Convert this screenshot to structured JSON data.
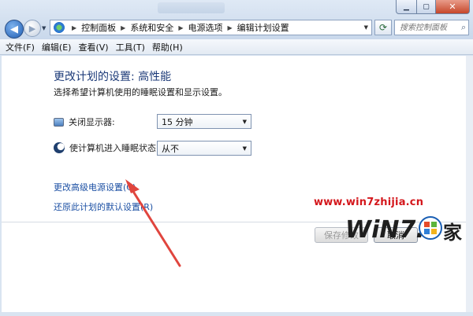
{
  "window": {
    "min_icon": "minimize-icon",
    "max_icon": "maximize-icon",
    "close_label": "✕"
  },
  "nav": {
    "back_icon": "back-arrow-icon",
    "forward_icon": "forward-arrow-icon"
  },
  "address": {
    "parts": [
      "控制面板",
      "系统和安全",
      "电源选项",
      "编辑计划设置"
    ]
  },
  "search": {
    "placeholder": "搜索控制面板"
  },
  "menu": {
    "file": "文件(F)",
    "edit": "编辑(E)",
    "view": "查看(V)",
    "tools": "工具(T)",
    "help": "帮助(H)"
  },
  "page": {
    "title": "更改计划的设置: 高性能",
    "description": "选择希望计算机使用的睡眠设置和显示设置。"
  },
  "settings": {
    "display_off_label": "关闭显示器:",
    "display_off_value": "15 分钟",
    "sleep_label": "使计算机进入睡眠状态:",
    "sleep_value": "从不"
  },
  "links": {
    "advanced": "更改高级电源设置(C)",
    "restore": "还原此计划的默认设置(R)"
  },
  "buttons": {
    "save": "保存修改",
    "cancel": "取消"
  },
  "watermark": {
    "url": "www.win7zhijia.cn",
    "logo_text": "WiN7.之家"
  },
  "colors": {
    "link": "#1b4fa3",
    "title": "#1c3a78",
    "annotation_arrow": "#e0453e",
    "watermark": "#d4171c"
  }
}
